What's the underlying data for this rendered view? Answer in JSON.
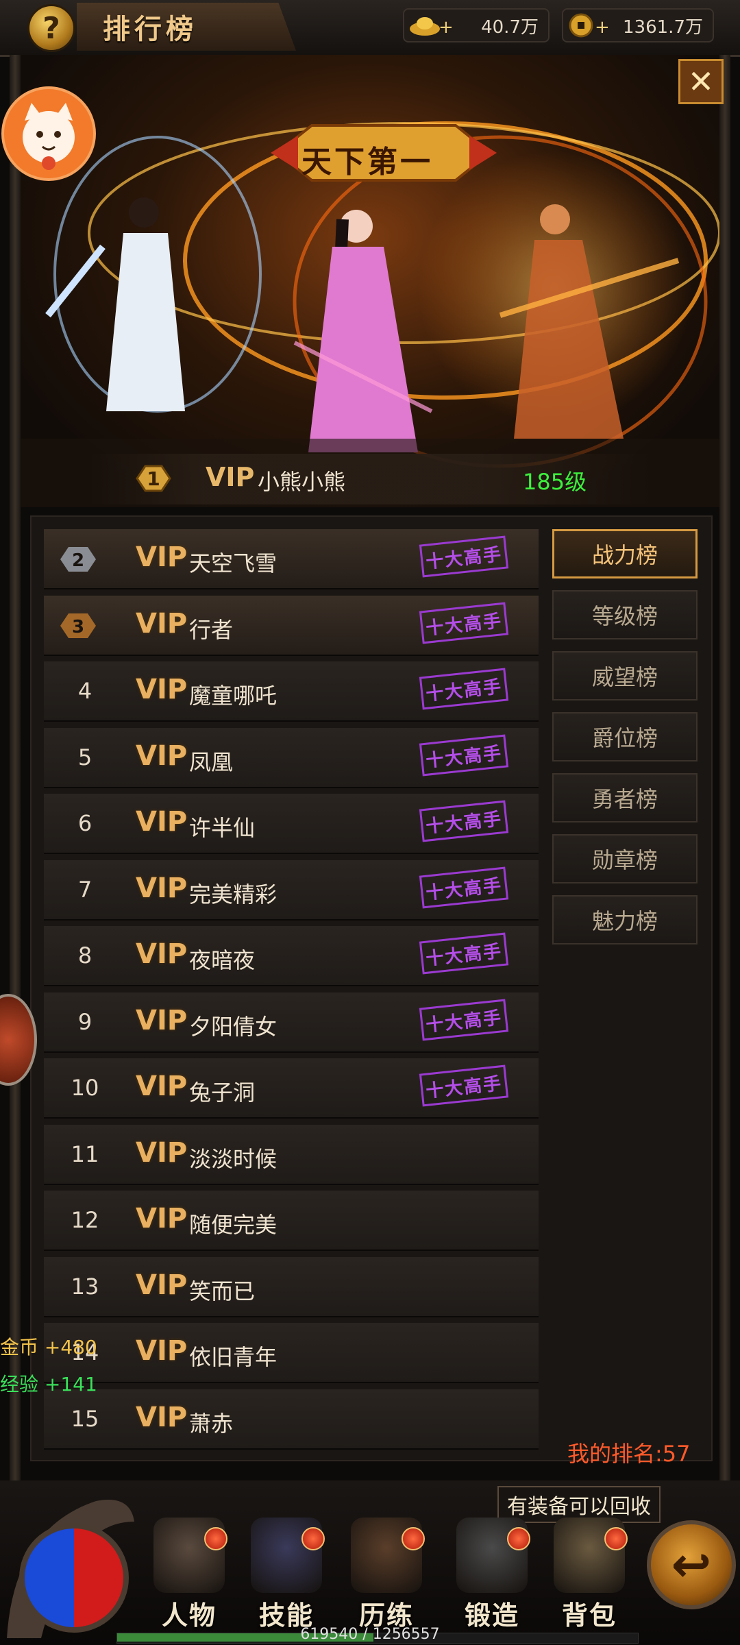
{
  "header": {
    "title": "排行榜",
    "help_icon": "?"
  },
  "currencies": [
    {
      "name": "gold-ingot-icon",
      "value": "40.7万"
    },
    {
      "name": "coin-icon",
      "value": "1361.7万"
    }
  ],
  "banner": {
    "badge_text": "天下第一",
    "champion": {
      "rank": "1",
      "vip": "VIP",
      "name": "小熊小熊",
      "level": "185级"
    }
  },
  "close_label": "✕",
  "ranking": {
    "stamp_label": "十大高手",
    "rows": [
      {
        "rank": "2",
        "vip": "VIP",
        "name": "天空飞雪",
        "stamp": true
      },
      {
        "rank": "3",
        "vip": "VIP",
        "name": "行者",
        "stamp": true
      },
      {
        "rank": "4",
        "vip": "VIP",
        "name": "魔童哪吒",
        "stamp": true
      },
      {
        "rank": "5",
        "vip": "VIP",
        "name": "凤凰",
        "stamp": true
      },
      {
        "rank": "6",
        "vip": "VIP",
        "name": "许半仙",
        "stamp": true
      },
      {
        "rank": "7",
        "vip": "VIP",
        "name": "完美精彩",
        "stamp": true
      },
      {
        "rank": "8",
        "vip": "VIP",
        "name": "夜暗夜",
        "stamp": true
      },
      {
        "rank": "9",
        "vip": "VIP",
        "name": "夕阳倩女",
        "stamp": true
      },
      {
        "rank": "10",
        "vip": "VIP",
        "name": "兔子洞",
        "stamp": true
      },
      {
        "rank": "11",
        "vip": "VIP",
        "name": "淡淡时候",
        "stamp": false
      },
      {
        "rank": "12",
        "vip": "VIP",
        "name": "随便完美",
        "stamp": false
      },
      {
        "rank": "13",
        "vip": "VIP",
        "name": "笑而已",
        "stamp": false
      },
      {
        "rank": "14",
        "vip": "VIP",
        "name": "依旧青年",
        "stamp": false
      },
      {
        "rank": "15",
        "vip": "VIP",
        "name": "萧赤",
        "stamp": false
      }
    ]
  },
  "tabs": [
    {
      "label": "战力榜",
      "active": true
    },
    {
      "label": "等级榜",
      "active": false
    },
    {
      "label": "威望榜",
      "active": false
    },
    {
      "label": "爵位榜",
      "active": false
    },
    {
      "label": "勇者榜",
      "active": false
    },
    {
      "label": "勋章榜",
      "active": false
    },
    {
      "label": "魅力榜",
      "active": false
    }
  ],
  "my_rank": "我的排名:57",
  "float_messages": {
    "gold": "金币  +480",
    "exp": "经验  +141"
  },
  "tooltip": "有装备可以回收",
  "bottom_nav": [
    {
      "label": "人物",
      "icon": "character-helmet-icon",
      "dot": true
    },
    {
      "label": "技能",
      "icon": "skill-book-icon",
      "dot": true
    },
    {
      "label": "历练",
      "icon": "training-emblem-icon",
      "dot": true
    },
    {
      "label": "锻造",
      "icon": "forge-hammer-icon",
      "dot": true
    },
    {
      "label": "背包",
      "icon": "backpack-icon",
      "dot": true
    }
  ],
  "exp_bar": {
    "text": "619540 / 1256557",
    "current": 619540,
    "max": 1256557
  },
  "colors": {
    "accent": "#d59a42",
    "vip": "#e8b060",
    "level_green": "#3df03d",
    "my_rank_red": "#ff5a2a",
    "stamp_purple": "#b44ee8"
  }
}
